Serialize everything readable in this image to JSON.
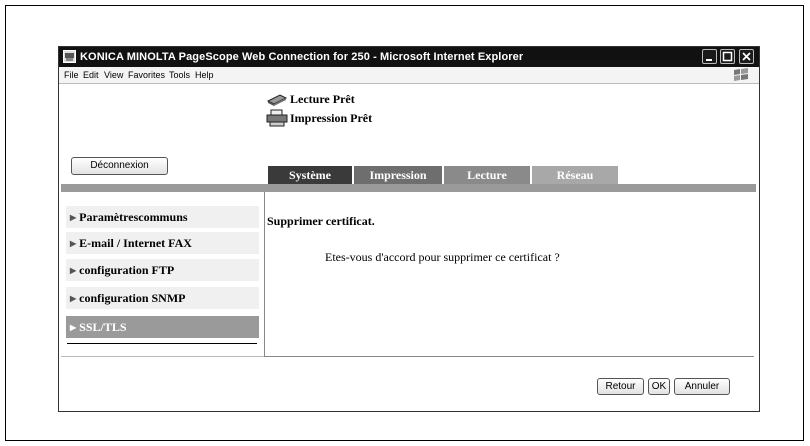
{
  "window": {
    "title": "KONICA MINOLTA PageScope Web Connection for 250 - Microsoft Internet Explorer",
    "controls": [
      "minimize",
      "maximize",
      "close"
    ]
  },
  "menubar": {
    "items": [
      "File",
      "Edit",
      "View",
      "Favorites",
      "Tools",
      "Help"
    ]
  },
  "status": {
    "scan": "Lecture Prêt",
    "print": "Impression Prêt"
  },
  "logout_label": "Déconnexion",
  "tabs": [
    {
      "label": "Système",
      "color": "#3a3a3a"
    },
    {
      "label": "Impression",
      "color": "#6e6e6e"
    },
    {
      "label": "Lecture",
      "color": "#8a8a8a"
    },
    {
      "label": "Réseau",
      "color": "#a8a8a8"
    }
  ],
  "sidebar": {
    "items": [
      {
        "label": "Paramètrescommuns"
      },
      {
        "label": "E-mail / Internet FAX"
      },
      {
        "label": "configuration FTP"
      },
      {
        "label": "configuration SNMP"
      },
      {
        "label": "SSL/TLS",
        "active": true
      }
    ]
  },
  "main": {
    "heading": "Supprimer certificat.",
    "message": "Etes-vous d'accord pour supprimer ce certificat ?"
  },
  "actions": {
    "back": "Retour",
    "ok": "OK",
    "cancel": "Annuler"
  },
  "colors": {
    "accent": "#9a9a9a",
    "titlebar": "#111111"
  }
}
